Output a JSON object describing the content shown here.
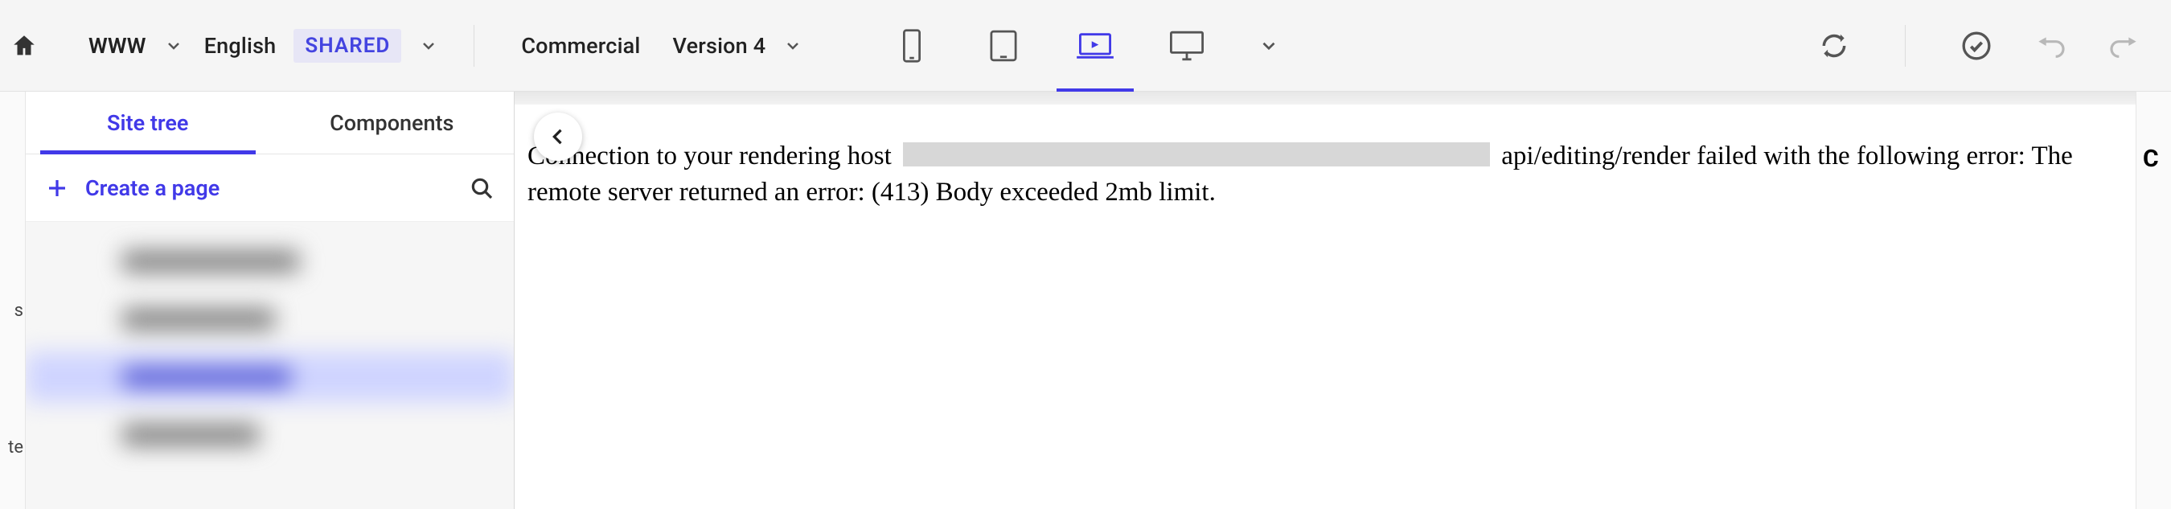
{
  "toolbar": {
    "site_label": "WWW",
    "language_label": "English",
    "shared_label": "SHARED",
    "workspace_label": "Commercial",
    "version_label": "Version 4"
  },
  "left_panel": {
    "tabs": {
      "site_tree": "Site tree",
      "components": "Components"
    },
    "create_page_label": "Create a page"
  },
  "error": {
    "part1": "Connection to your rendering host",
    "part2": "api/editing/render failed with the following error: The remote server returned an error: (413) Body exceeded 2mb limit."
  },
  "gutter": {
    "a": "s",
    "b": "te"
  },
  "rightrail": {
    "clip": "C"
  }
}
